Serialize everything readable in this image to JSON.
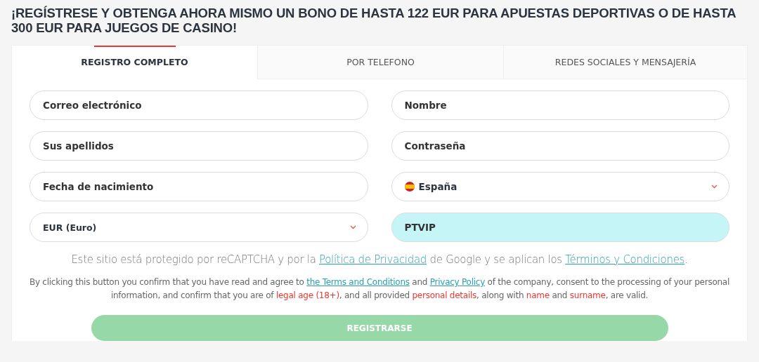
{
  "heading": "¡REGÍSTRESE Y OBTENGA AHORA MISMO UN BONO DE HASTA 122 EUR PARA APUESTAS DEPORTIVAS O DE HASTA 300 EUR PARA JUEGOS DE CASINO!",
  "tabs": [
    {
      "label": "REGISTRO COMPLETO",
      "selected": true
    },
    {
      "label": "POR TELEFONO",
      "selected": false
    },
    {
      "label": "REDES SOCIALES Y MENSAJERÍA",
      "selected": false
    }
  ],
  "fields": [
    {
      "kind": "text",
      "placeholder": "Correo electrónico",
      "highlighted": false
    },
    {
      "kind": "text",
      "placeholder": "Nombre",
      "highlighted": false
    },
    {
      "kind": "text",
      "placeholder": "Sus apellidos",
      "highlighted": false
    },
    {
      "kind": "text",
      "placeholder": "Contraseña",
      "highlighted": false
    },
    {
      "kind": "text",
      "placeholder": "Fecha de nacimiento",
      "highlighted": false
    },
    {
      "kind": "country",
      "value": "España",
      "highlighted": false
    },
    {
      "kind": "select",
      "value": "EUR (Euro)",
      "highlighted": false
    },
    {
      "kind": "text",
      "value": "PTVIP",
      "highlighted": true
    }
  ],
  "recaptcha_notice": [
    {
      "kind": "plain",
      "text": "Este sitio está protegido por reCAPTCHA y por la "
    },
    {
      "kind": "link",
      "text": "Política de Privacidad"
    },
    {
      "kind": "plain",
      "text": " de Google y se aplican los "
    },
    {
      "kind": "link",
      "text": "Términos y Condiciones"
    },
    {
      "kind": "plain",
      "text": "."
    }
  ],
  "consent_notice": [
    {
      "kind": "plain",
      "text": "By clicking this button you confirm that you have read and agree to "
    },
    {
      "kind": "link",
      "text": "the Terms and Conditions"
    },
    {
      "kind": "plain",
      "text": " and "
    },
    {
      "kind": "link",
      "text": "Privacy Policy"
    },
    {
      "kind": "plain",
      "text": " of the company, consent to the processing of your personal information, and confirm that you are of "
    },
    {
      "kind": "accent",
      "text": "legal age (18+)"
    },
    {
      "kind": "plain",
      "text": ", and all provided "
    },
    {
      "kind": "accent",
      "text": "personal details"
    },
    {
      "kind": "plain",
      "text": ", along with "
    },
    {
      "kind": "accent",
      "text": "name"
    },
    {
      "kind": "plain",
      "text": " and "
    },
    {
      "kind": "accent",
      "text": "surname"
    },
    {
      "kind": "plain",
      "text": ", are valid."
    }
  ],
  "submit_button": {
    "label": "REGISTRARSE",
    "disabled": true
  }
}
